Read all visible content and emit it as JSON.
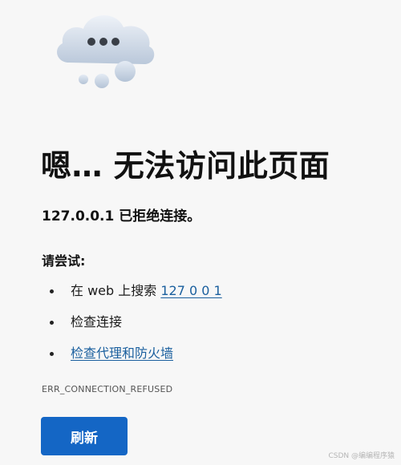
{
  "error_page": {
    "title": "嗯… 无法访问此页面",
    "message": "127.0.0.1 已拒绝连接。",
    "try_heading": "请尝试:",
    "suggestion_search_prefix": "在 web 上搜索 ",
    "suggestion_search_link": "127 0 0 1",
    "suggestion_check_connection": "检查连接",
    "suggestion_check_proxy_link": "检查代理和防火墙",
    "error_code": "ERR_CONNECTION_REFUSED",
    "refresh_label": "刷新"
  },
  "watermark": "CSDN @编编程序猿",
  "icons": {
    "illustration": "cloud-error-icon"
  },
  "colors": {
    "link": "#1a5f9e",
    "button": "#1466c5",
    "background": "#f7f7f7"
  }
}
